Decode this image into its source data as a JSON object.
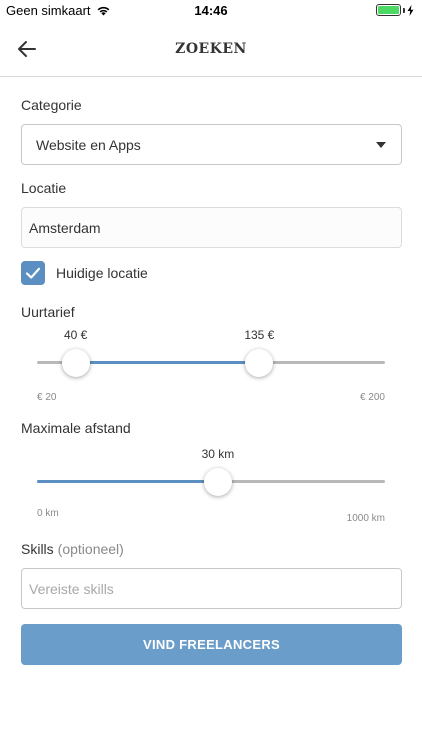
{
  "status_bar": {
    "carrier": "Geen simkaart",
    "time": "14:46"
  },
  "header": {
    "title": "ZOEKEN"
  },
  "category": {
    "label": "Categorie",
    "selected": "Website en Apps"
  },
  "location": {
    "label": "Locatie",
    "value": "Amsterdam",
    "use_current_label": "Huidige locatie",
    "use_current_checked": true
  },
  "hourly_rate": {
    "label": "Uurtarief",
    "min": 20,
    "max": 200,
    "low": 40,
    "high": 135,
    "low_text": "40 €",
    "high_text": "135 €",
    "min_text": "€ 20",
    "max_text": "€ 200"
  },
  "distance": {
    "label": "Maximale afstand",
    "value_text": "30 km",
    "fraction": 0.52,
    "min_text": "0 km",
    "max_text": "1000 km"
  },
  "skills": {
    "label": "Skills",
    "optional_label": "(optioneel)",
    "placeholder": "Vereiste skills"
  },
  "submit": {
    "label": "VIND FREELANCERS"
  },
  "colors": {
    "accent": "#5b8fc1",
    "button": "#6b9dca",
    "battery": "#4cd964"
  }
}
